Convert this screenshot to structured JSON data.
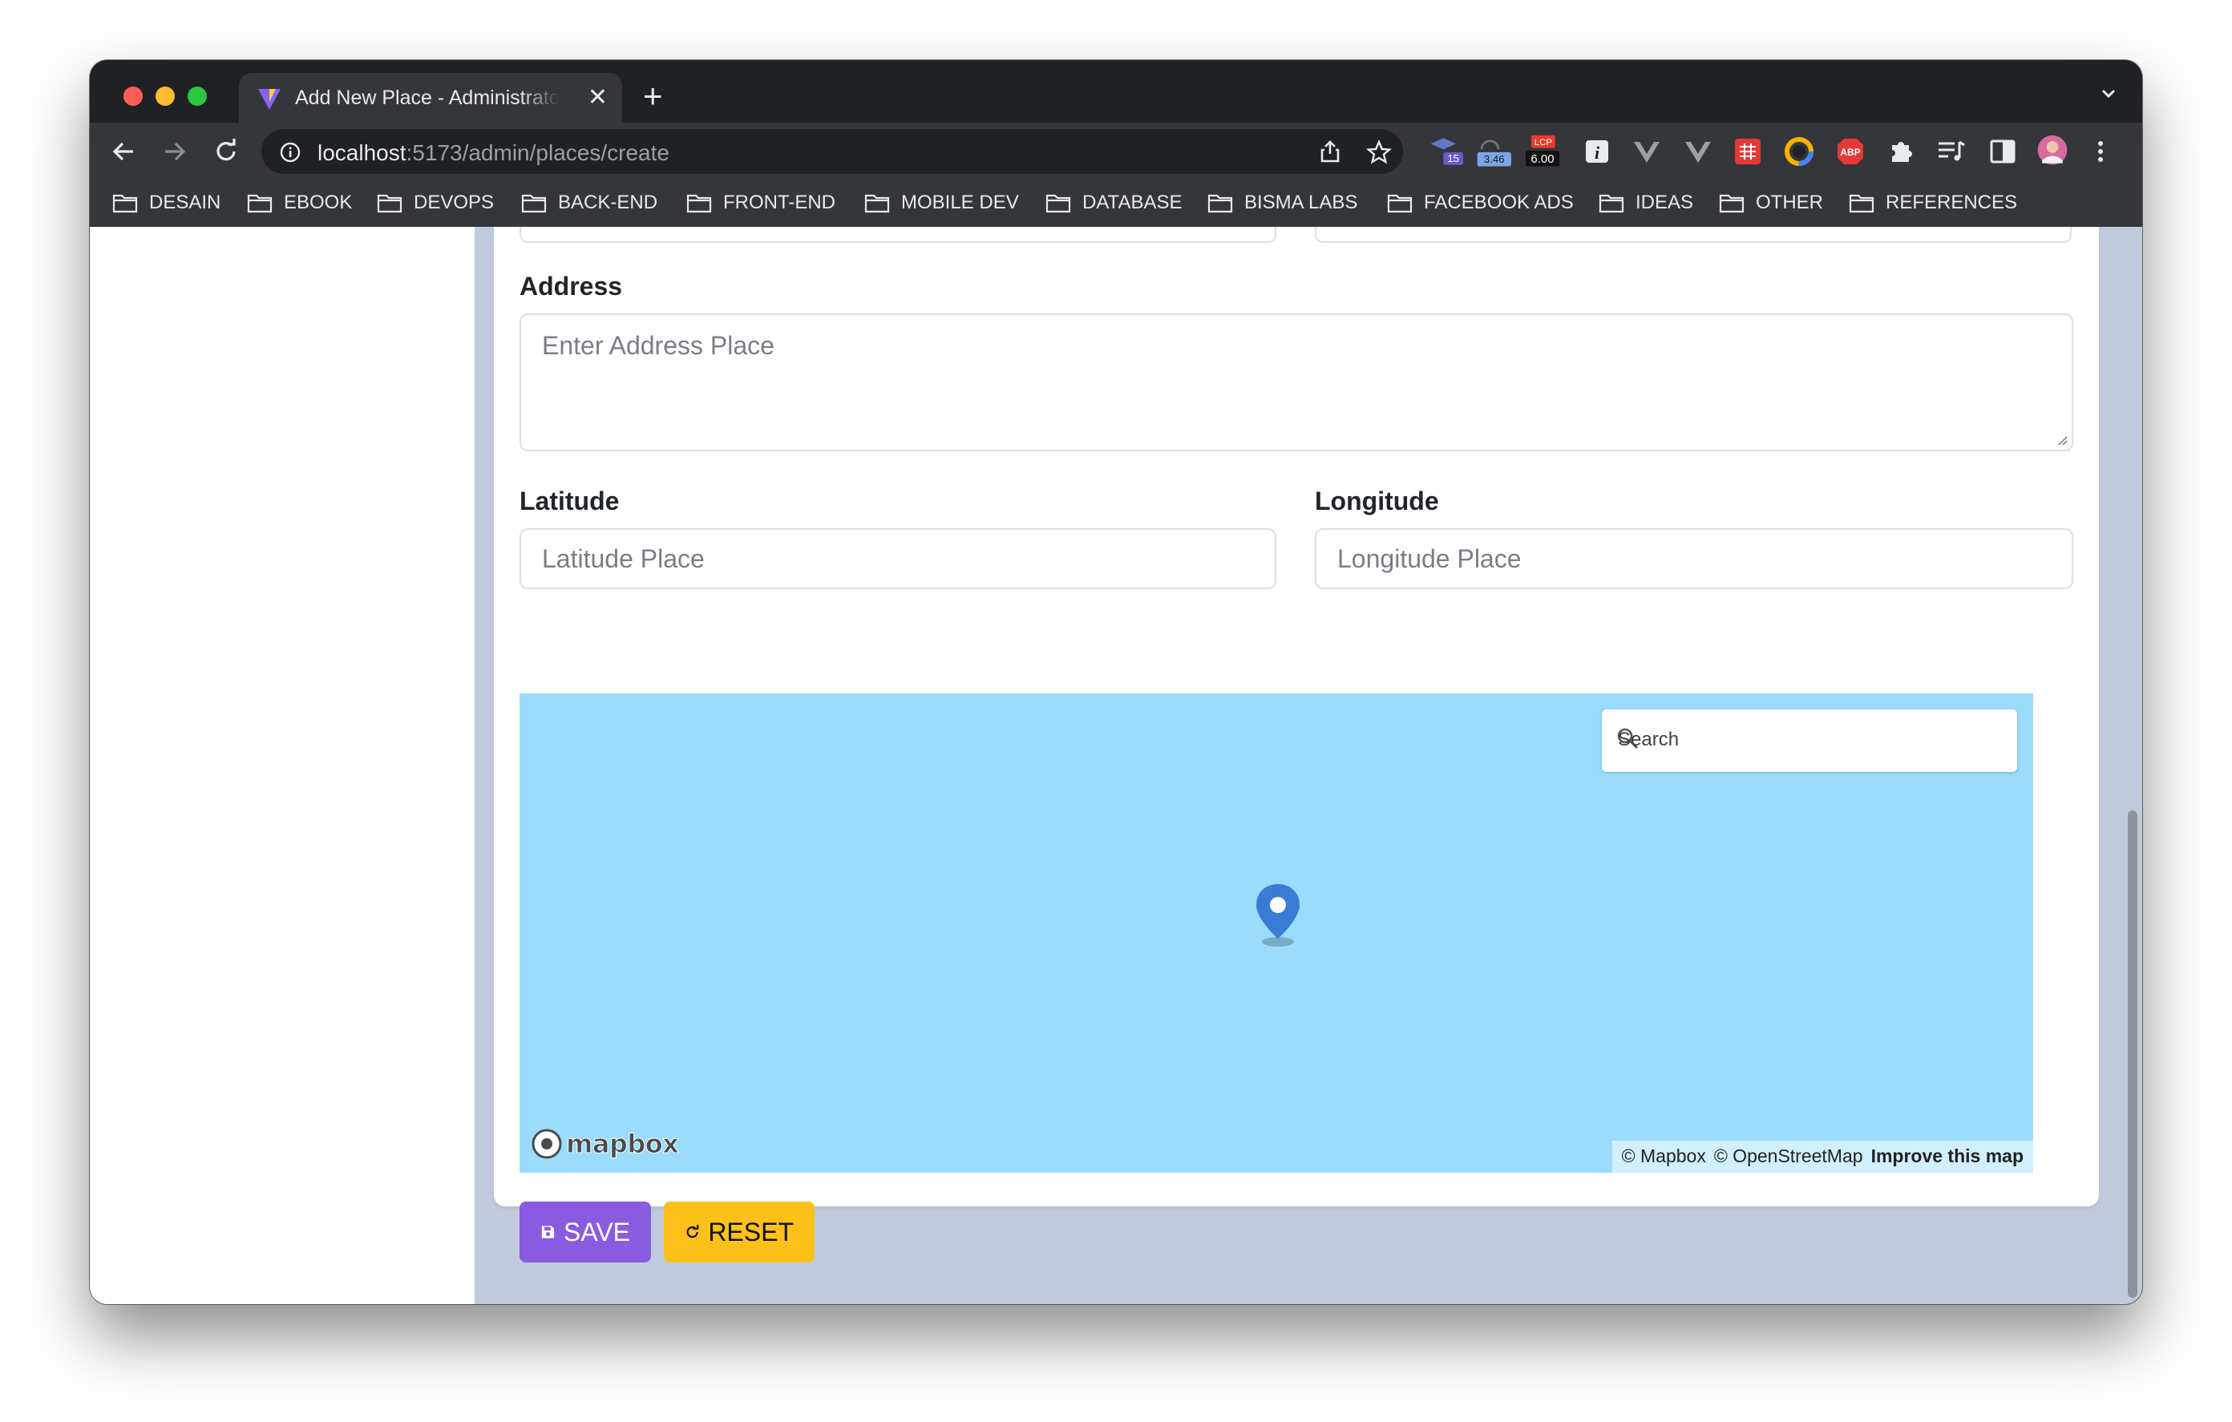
{
  "browser": {
    "tab_title": "Add New Place - Administrator",
    "url_host": "localhost",
    "url_path": ":5173/admin/places/create",
    "extensions": {
      "badge_1": "15",
      "badge_2": "3.46",
      "lcp_label": "LCP",
      "lcp_value": "6.00",
      "abp_label": "ABP"
    },
    "bookmarks": [
      "DESAIN",
      "EBOOK",
      "DEVOPS",
      "BACK-END",
      "FRONT-END",
      "MOBILE DEV",
      "DATABASE",
      "BISMA LABS",
      "FACEBOOK ADS",
      "IDEAS",
      "OTHER",
      "REFERENCES"
    ]
  },
  "form": {
    "address_label": "Address",
    "address_placeholder": "Enter Address Place",
    "latitude_label": "Latitude",
    "latitude_placeholder": "Latitude Place",
    "longitude_label": "Longitude",
    "longitude_placeholder": "Longitude Place"
  },
  "map": {
    "search_placeholder": "Search",
    "logo_text": "mapbox",
    "attribution_mapbox": "© Mapbox",
    "attribution_osm": "© OpenStreetMap",
    "improve_link": "Improve this map",
    "water_color": "#9bdcfc",
    "marker_color": "#3a7bd5"
  },
  "actions": {
    "save_label": "SAVE",
    "reset_label": "RESET",
    "save_color": "#8a5be0",
    "reset_color": "#fcc018"
  }
}
